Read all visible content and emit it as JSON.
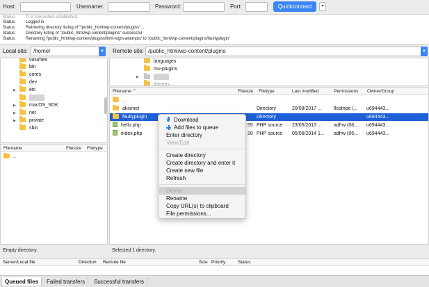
{
  "quickconnect": {
    "host_label": "Host:",
    "host_value": "",
    "username_label": "Username:",
    "username_value": "",
    "password_label": "Password:",
    "password_value": "",
    "port_label": "Port:",
    "port_value": "",
    "quickconnect_label": "Quickconnect",
    "history_dropdown": "▾"
  },
  "log": [
    {
      "key": "Status:",
      "text": "TLS connection established."
    },
    {
      "key": "Status:",
      "text": "Logged in"
    },
    {
      "key": "Status:",
      "text": "Retrieving directory listing of \"/public_html/wp-content/plugins\"..."
    },
    {
      "key": "Status:",
      "text": "Directory listing of \"/public_html/wp-content/plugins\" successful"
    },
    {
      "key": "Status:",
      "text": "Renaming '/public_html/wp-content/plugins/limit-login-attempts' to '/public_html/wp-content/plugins/faultyplugin'"
    }
  ],
  "local": {
    "label": "Local site:",
    "path": "/home/",
    "tree": [
      "volumes",
      "bin",
      "cores",
      "dev",
      "etc",
      "home",
      "macOS_SDK",
      "net",
      "private",
      "sbin"
    ],
    "headers": {
      "filename": "Filename",
      "filesize": "Filesize",
      "filetype": "Filetype"
    },
    "files": [
      ".."
    ],
    "status": "Empty directory."
  },
  "remote": {
    "label": "Remote site:",
    "path": "/public_html/wp-content/plugins",
    "tree": [
      "languages",
      "mu-plugins",
      "plugins",
      "themes"
    ],
    "headers": {
      "filename": "Filename",
      "sort": "⌃",
      "filesize": "Filesize",
      "filetype": "Filetype",
      "modified": "Last modified",
      "permissions": "Permissions",
      "owner": "Owner/Group"
    },
    "files": [
      {
        "name": "..",
        "size": "",
        "type": "",
        "modified": "",
        "perms": "",
        "owner": ""
      },
      {
        "name": "akismet",
        "size": "",
        "type": "Directory",
        "modified": "20/09/2017 ...",
        "perms": "flcdmpe (...",
        "owner": "u694443..."
      },
      {
        "name": "faultyplugin",
        "size": "",
        "type": "Directory",
        "modified": "",
        "perms": "",
        "owner": "u694443..."
      },
      {
        "name": "hello.php",
        "size": "55",
        "type": "PHP source",
        "modified": "23/05/2013 ...",
        "perms": "adfrw (06...",
        "owner": "u694443..."
      },
      {
        "name": "index.php",
        "size": "28",
        "type": "PHP source",
        "modified": "05/06/2014 1...",
        "perms": "adfrw (06...",
        "owner": "u694443..."
      }
    ],
    "status": "Selected 1 directory."
  },
  "context_menu": {
    "download": "Download",
    "add_to_queue": "Add files to queue",
    "enter_directory": "Enter directory",
    "view_edit": "View/Edit",
    "create_directory": "Create directory",
    "create_directory_enter": "Create directory and enter it",
    "create_new_file": "Create new file",
    "refresh": "Refresh",
    "delete": "Delete",
    "rename": "Rename",
    "copy_urls": "Copy URL(s) to clipboard",
    "file_permissions": "File permissions..."
  },
  "queue": {
    "headers": {
      "server_file": "Server/Local file",
      "direction": "Direction",
      "remote_file": "Remote file",
      "size": "Size",
      "priority": "Priority",
      "status": "Status"
    },
    "tabs": [
      "Queued files",
      "Failed transfers",
      "Successful transfers"
    ]
  },
  "colors": {
    "accent": "#3b86f5",
    "selection": "#1d5fd6",
    "folder": "#f5c242"
  }
}
